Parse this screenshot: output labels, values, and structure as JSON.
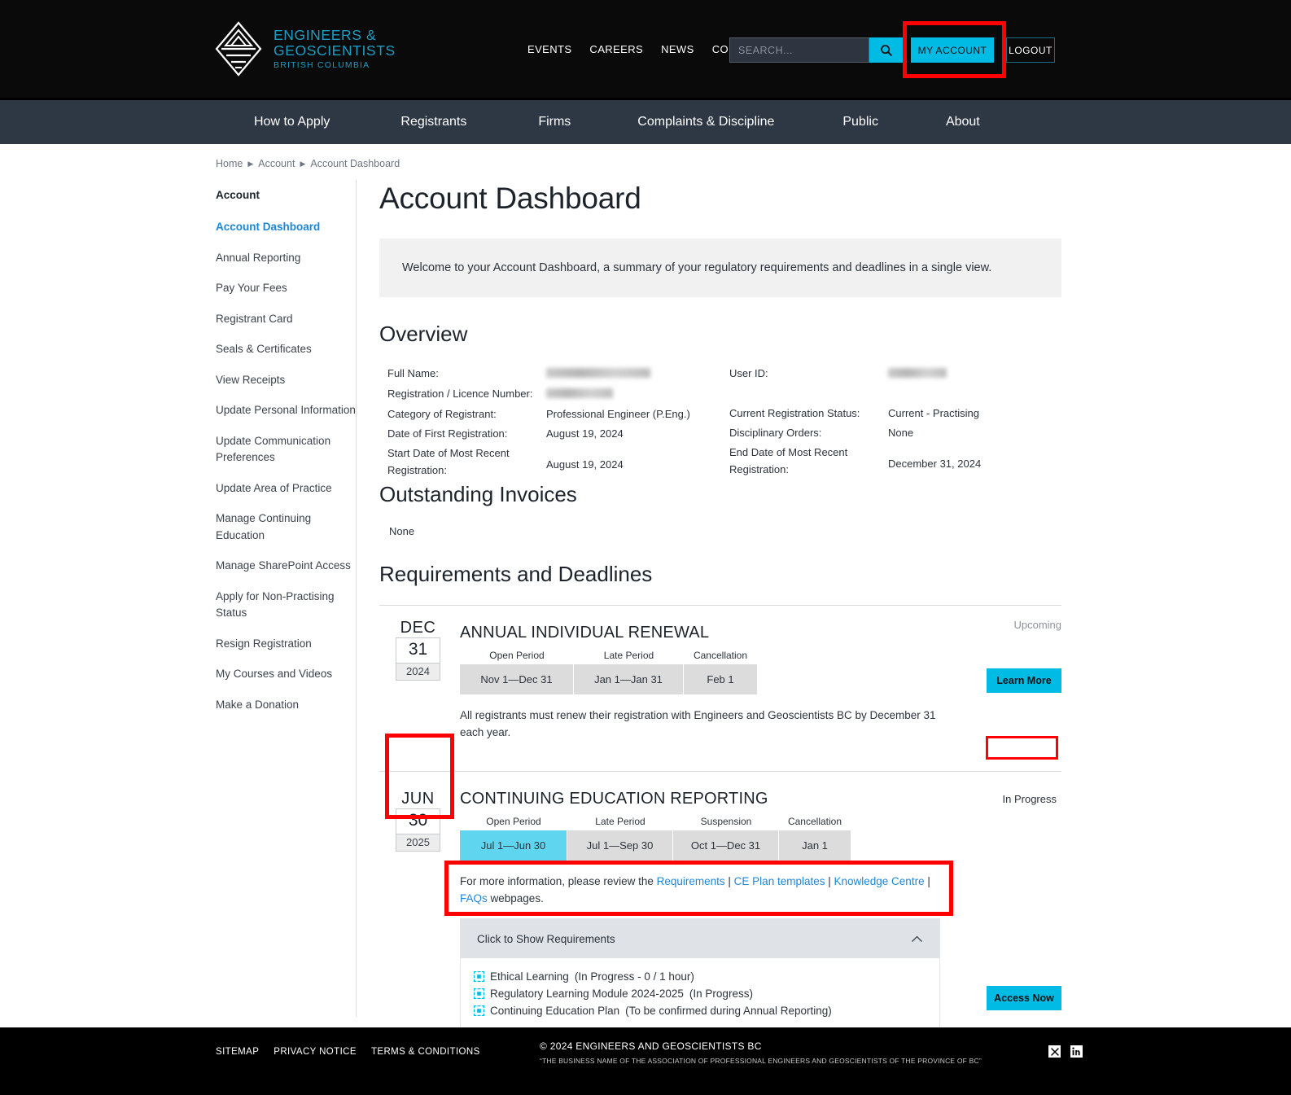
{
  "brand": {
    "name_line1": "ENGINEERS &",
    "name_line2": "GEOSCIENTISTS",
    "name_line3": "BRITISH COLUMBIA",
    "accent_color": "#1b9dc4",
    "cta_color": "#00bce4"
  },
  "topnav": {
    "links": [
      {
        "label": "EVENTS"
      },
      {
        "label": "CAREERS"
      },
      {
        "label": "NEWS"
      },
      {
        "label": "CONTACT"
      }
    ],
    "search": {
      "value": "",
      "placeholder": "SEARCH..."
    },
    "my_account_label": "MY ACCOUNT",
    "logout_label": "LOGOUT"
  },
  "mainnav": {
    "items": [
      {
        "label": "How to Apply"
      },
      {
        "label": "Registrants"
      },
      {
        "label": "Firms"
      },
      {
        "label": "Complaints & Discipline"
      },
      {
        "label": "Public"
      },
      {
        "label": "About"
      }
    ]
  },
  "breadcrumb": {
    "items": [
      {
        "label": "Home"
      },
      {
        "label": "Account"
      },
      {
        "label": "Account Dashboard"
      }
    ],
    "separator": "▶"
  },
  "sidebar": {
    "heading": "Account",
    "items": [
      {
        "label": "Account Dashboard",
        "active": true
      },
      {
        "label": "Annual Reporting"
      },
      {
        "label": "Pay Your Fees"
      },
      {
        "label": "Registrant Card"
      },
      {
        "label": "Seals & Certificates"
      },
      {
        "label": "View Receipts"
      },
      {
        "label": "Update Personal Information"
      },
      {
        "label": "Update Communication Preferences"
      },
      {
        "label": "Update Area of Practice"
      },
      {
        "label": "Manage Continuing Education"
      },
      {
        "label": "Manage SharePoint Access"
      },
      {
        "label": "Apply for Non-Practising Status"
      },
      {
        "label": "Resign Registration"
      },
      {
        "label": "My Courses and Videos"
      },
      {
        "label": "Make a Donation"
      }
    ]
  },
  "main": {
    "page_title": "Account Dashboard",
    "welcome_text": "Welcome to your Account Dashboard, a summary of your regulatory requirements and deadlines in a single view.",
    "overview": {
      "heading": "Overview",
      "left": [
        {
          "label": "Full Name:",
          "value": "",
          "redacted": true
        },
        {
          "label": "Registration / Licence Number:",
          "value": "",
          "redacted": true
        },
        {
          "label": "Category of Registrant:",
          "value": "Professional Engineer (P.Eng.)"
        },
        {
          "label": "Date of First Registration:",
          "value": "August 19, 2024"
        },
        {
          "label": "Start Date of Most Recent Registration:",
          "value": "August 19, 2024"
        }
      ],
      "right": [
        {
          "label": "User ID:",
          "value": "",
          "redacted": true
        },
        {
          "label": "Current Registration Status:",
          "value": "Current - Practising"
        },
        {
          "label": "Disciplinary Orders:",
          "value": "None"
        },
        {
          "label": "End Date of Most Recent Registration:",
          "value": "December 31, 2024"
        }
      ]
    },
    "invoices": {
      "heading": "Outstanding Invoices",
      "value": "None"
    },
    "requirements": {
      "heading": "Requirements and Deadlines",
      "cards": [
        {
          "date": {
            "month": "DEC",
            "day": "31",
            "year": "2024"
          },
          "title": "ANNUAL INDIVIDUAL RENEWAL",
          "status": "Upcoming",
          "cta": "Learn More",
          "period_headers": [
            "Open Period",
            "Late Period",
            "Cancellation"
          ],
          "period_values": [
            "Nov 1—Dec 31",
            "Jan 1—Jan 31",
            "Feb 1"
          ],
          "active_period_index": -1,
          "note": "All registrants must renew their registration with Engineers and Geoscientists BC by December 31 each year."
        },
        {
          "date": {
            "month": "JUN",
            "day": "30",
            "year": "2025"
          },
          "title": "CONTINUING EDUCATION REPORTING",
          "status": "In Progress",
          "cta": "Access Now",
          "period_headers": [
            "Open Period",
            "Late Period",
            "Suspension",
            "Cancellation"
          ],
          "period_values": [
            "Jul 1—Jun 30",
            "Jul 1—Sep 30",
            "Oct 1—Dec 31",
            "Jan 1"
          ],
          "active_period_index": 0,
          "note_prefix": "For more information, please review the ",
          "note_links": [
            "Requirements",
            "CE Plan templates",
            "Knowledge Centre",
            "FAQs"
          ],
          "note_suffix": " webpages."
        }
      ]
    },
    "accordion": {
      "header_label": "Click to Show Requirements",
      "chevron": "chevron-up-icon",
      "expanded": true,
      "items": [
        {
          "name": "Ethical Learning",
          "detail": "(In Progress - 0 / 1 hour)"
        },
        {
          "name": "Regulatory Learning Module 2024-2025",
          "detail": "(In Progress)"
        },
        {
          "name": "Continuing Education Plan",
          "detail": "(To be confirmed during Annual Reporting)"
        }
      ]
    }
  },
  "footer": {
    "links": [
      {
        "label": "SITEMAP"
      },
      {
        "label": "PRIVACY NOTICE"
      },
      {
        "label": "TERMS & CONDITIONS"
      }
    ],
    "copyright": "© 2024 ENGINEERS AND GEOSCIENTISTS BC",
    "legal": "“THE BUSINESS NAME OF THE ASSOCIATION OF PROFESSIONAL ENGINEERS AND GEOSCIENTISTS OF THE PROVINCE OF BC”",
    "social": [
      {
        "name": "x-twitter-icon",
        "glyph": "𝕏"
      },
      {
        "name": "linkedin-icon",
        "glyph": "in"
      }
    ]
  },
  "annotations": {
    "color": "#ff0000",
    "boxes": [
      {
        "target": "my-account-button"
      },
      {
        "target": "ce-date-badge"
      },
      {
        "target": "ce-status-in-progress"
      },
      {
        "target": "show-requirements-accordion-header"
      }
    ]
  }
}
